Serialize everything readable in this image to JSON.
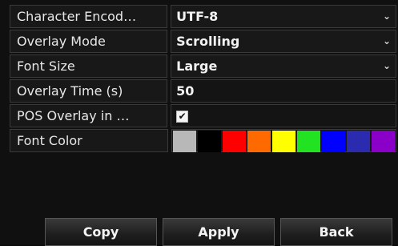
{
  "rows": {
    "encoding": {
      "label": "Character Encod…",
      "value": "UTF-8"
    },
    "overlay_mode": {
      "label": "Overlay Mode",
      "value": "Scrolling"
    },
    "font_size": {
      "label": "Font Size",
      "value": "Large"
    },
    "overlay_time": {
      "label": "Overlay Time (s)",
      "value": "50"
    },
    "pos_overlay": {
      "label": "POS Overlay in …",
      "checked": true,
      "check_glyph": "✔"
    },
    "font_color": {
      "label": "Font Color"
    }
  },
  "dropdown_glyph": "⌄",
  "font_colors": [
    "#b8b8b8",
    "#000000",
    "#ff0000",
    "#ff6a00",
    "#ffff00",
    "#22e322",
    "#0000ff",
    "#2b2bb0",
    "#8a00c8"
  ],
  "buttons": {
    "copy": "Copy",
    "apply": "Apply",
    "back": "Back"
  }
}
